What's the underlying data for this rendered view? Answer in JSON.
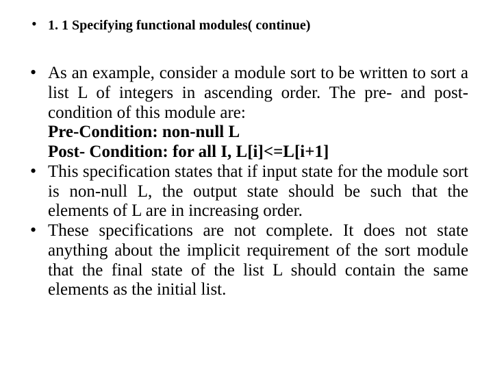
{
  "heading": "1. 1 Specifying functional modules( continue)",
  "bullets": {
    "intro": "As an example, consider a module sort to be written to sort a list L of integers in ascending order. The pre- and post- condition of this module are:",
    "pre_condition": "Pre-Condition: non-null L",
    "post_condition": "Post- Condition: for all I, L[i]<=L[i+1]",
    "spec_states": "This specification states that if input state for the module sort is non-null L, the output state should be such that the elements of L are in increasing order.",
    "incomplete": "These specifications are not complete. It does not state anything about the implicit requirement of the sort module that the final state of the list L should contain the same elements as the initial list."
  }
}
